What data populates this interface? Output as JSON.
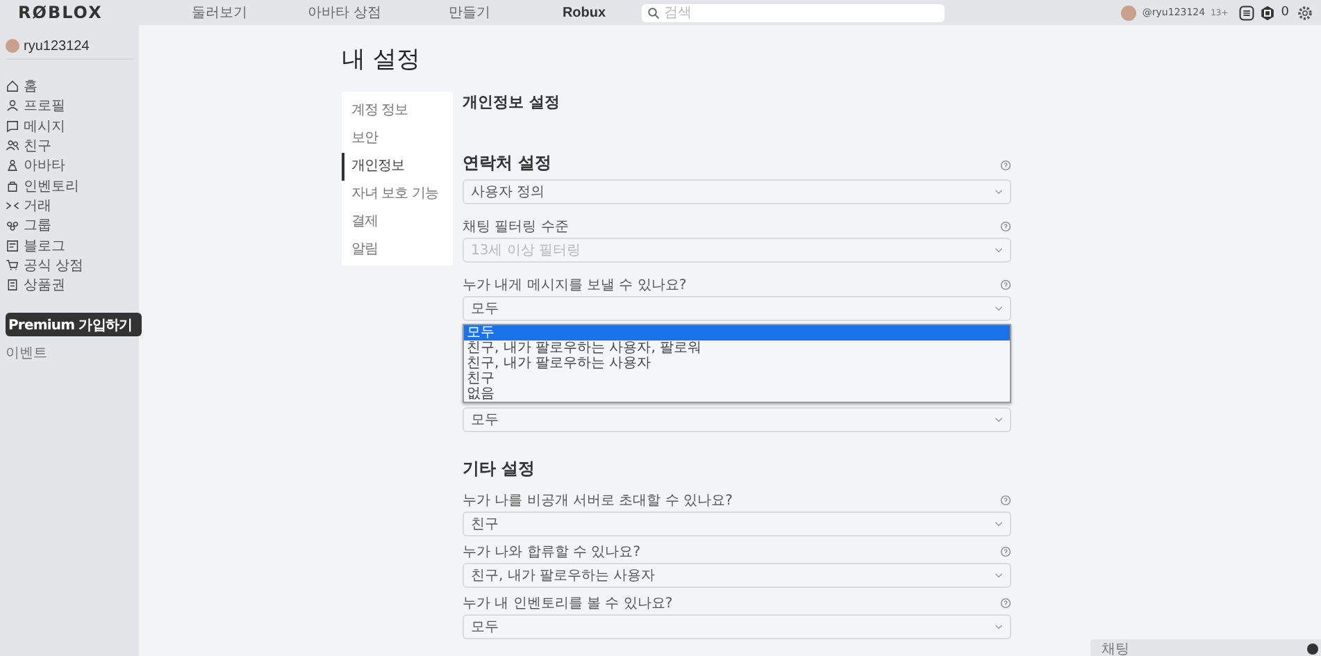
{
  "header": {
    "logo": "RØBLOX",
    "nav": [
      "둘러보기",
      "아바타 상점",
      "만들기",
      "Robux"
    ],
    "search": {
      "placeholder": "검색"
    },
    "username": "@ryu123124",
    "age_badge": "13+",
    "robux_count": "0"
  },
  "sidebar": {
    "username": "ryu123124",
    "items": [
      "홈",
      "프로필",
      "메시지",
      "친구",
      "아바타",
      "인벤토리",
      "거래",
      "그룹",
      "블로그",
      "공식 상점",
      "상품권"
    ],
    "premium_button": "Premium 가입하기",
    "events": "이벤트"
  },
  "page_title": "내 설정",
  "settings_nav": [
    {
      "label": "계정 정보",
      "selected": false
    },
    {
      "label": "보안",
      "selected": false
    },
    {
      "label": "개인정보",
      "selected": true
    },
    {
      "label": "자녀 보호 기능",
      "selected": false
    },
    {
      "label": "결제",
      "selected": false
    },
    {
      "label": "알림",
      "selected": false
    }
  ],
  "privacy": {
    "title": "개인정보 설정",
    "sections": [
      {
        "heading": "연락처 설정",
        "help": true,
        "fields": [
          {
            "value": "사용자 정의",
            "disabled": false
          },
          {
            "label": "채팅 필터링 수준",
            "help": true,
            "value": "13세 이상 필터링",
            "disabled": true
          },
          {
            "label": "누가 내게 메시지를 보낼 수 있나요?",
            "help": true,
            "value": "모두",
            "disabled": false,
            "options": [
              {
                "label": "모두",
                "selected": true
              },
              {
                "label": "친구, 내가 팔로우하는 사용자, 팔로워",
                "selected": false
              },
              {
                "label": "친구, 내가 팔로우하는 사용자",
                "selected": false
              },
              {
                "label": "친구",
                "selected": false
              },
              {
                "label": "없음",
                "selected": false
              }
            ]
          },
          {
            "value": "모두",
            "disabled": false
          }
        ]
      },
      {
        "heading": "기타 설정",
        "fields": [
          {
            "label": "누가 나를 비공개 서버로 초대할 수 있나요?",
            "help": true,
            "value": "친구",
            "disabled": false
          },
          {
            "label": "누가 나와 합류할 수 있나요?",
            "help": true,
            "value": "친구, 내가 팔로우하는 사용자",
            "disabled": false
          },
          {
            "label": "누가 내 인벤토리를 볼 수 있나요?",
            "help": true,
            "value": "모두",
            "disabled": false
          }
        ]
      }
    ]
  },
  "chat_bar": {
    "label": "채팅"
  }
}
